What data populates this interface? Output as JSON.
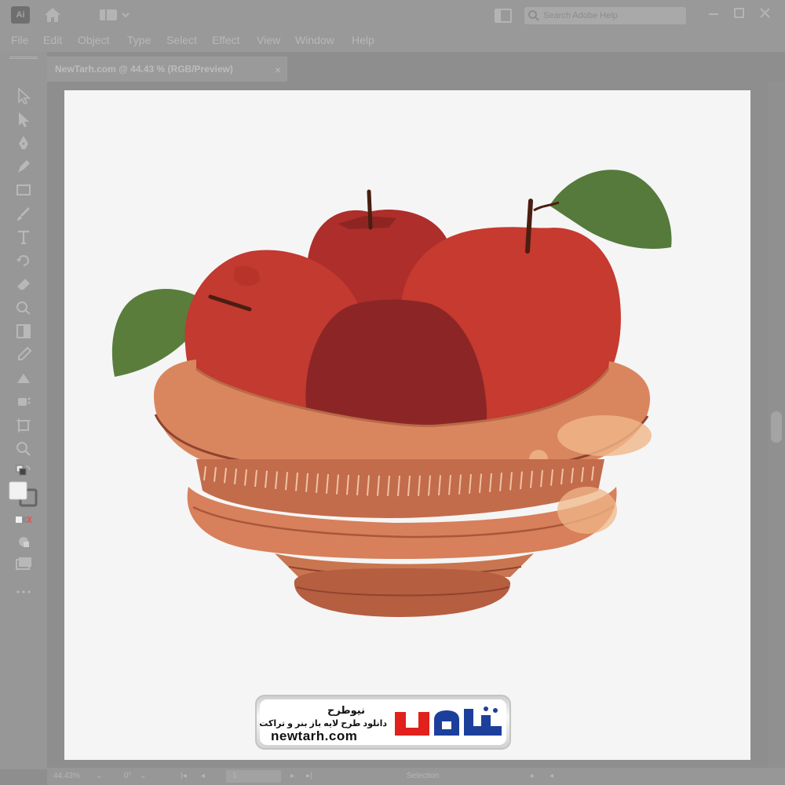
{
  "app": {
    "logo_text": "Ai"
  },
  "titlebar": {
    "search_placeholder": "Search Adobe Help",
    "icons": [
      "illustrator-logo-icon",
      "home-icon",
      "workspace-switcher-icon",
      "arrange-documents-icon",
      "search-icon",
      "minimize-icon",
      "maximize-icon",
      "close-icon"
    ]
  },
  "menu": {
    "items": [
      "File",
      "Edit",
      "Object",
      "Type",
      "Select",
      "Effect",
      "View",
      "Window",
      "Help"
    ]
  },
  "document_tab": {
    "title": "NewTarh.com @ 44.43 % (RGB/Preview)",
    "close": "×"
  },
  "tools": [
    "selection-tool-icon",
    "direct-selection-tool-icon",
    "pen-tool-icon",
    "curvature-tool-icon",
    "rectangle-tool-icon",
    "paintbrush-tool-icon",
    "type-tool-icon",
    "rotate-tool-icon",
    "eraser-tool-icon",
    "shape-builder-tool-icon",
    "gradient-tool-icon",
    "eyedropper-tool-icon",
    "blend-tool-icon",
    "symbol-sprayer-tool-icon",
    "artboard-tool-icon",
    "zoom-tool-icon"
  ],
  "status": {
    "zoom": "44.43%",
    "rotation": "0°",
    "artboard_number": "1",
    "tool_name": "Selection"
  },
  "watermark": {
    "title": "نیوطرح",
    "tagline": "دانلود طرح لایه باز بنر و تراکت",
    "url": "newtarh.com",
    "logo_text": "نیوطرح"
  },
  "colors": {
    "apple_red": "#c63a2f",
    "apple_dark": "#8c2626",
    "apple_back": "#b0302b",
    "leaf_green": "#5a7d3c",
    "bowl_light": "#d9865f",
    "bowl_mid": "#c97550",
    "bowl_dark": "#a8553a",
    "logo_red": "#e0211c",
    "logo_blue": "#1d3f9c"
  }
}
